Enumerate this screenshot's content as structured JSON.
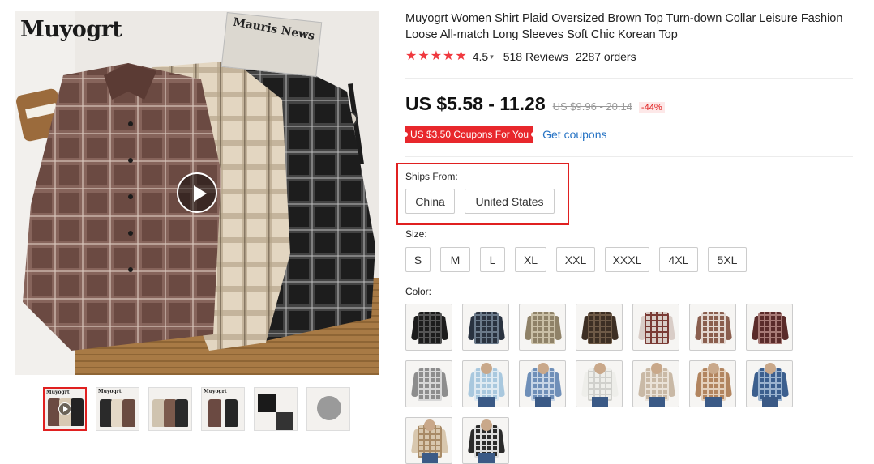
{
  "gallery": {
    "brand_logo": "Muyogrt",
    "newspaper_text": "Mauris News",
    "play_icon": "play-icon",
    "thumbnails": [
      {
        "label": "Muyogrt",
        "kind": "video",
        "active": true
      },
      {
        "label": "Muyogrt",
        "kind": "flatlay",
        "active": false
      },
      {
        "label": "",
        "kind": "rack",
        "active": false
      },
      {
        "label": "Muyogrt",
        "kind": "hanging",
        "active": false
      },
      {
        "label": "",
        "kind": "fabric",
        "active": false
      },
      {
        "label": "",
        "kind": "detail",
        "active": false
      }
    ]
  },
  "product": {
    "title": "Muyogrt Women Shirt Plaid Oversized Brown Top Turn-down Collar Leisure Fashion Loose All-match Long Sleeves Soft Chic Korean Top",
    "rating": "4.5",
    "reviews": "518 Reviews",
    "orders": "2287 orders",
    "price": "US $5.58 - 11.28",
    "original_price": "US $9.96 - 20.14",
    "discount": "-44%",
    "coupon_badge": "US $3.50 Coupons For You",
    "get_coupons": "Get coupons",
    "colors": {
      "star": "#f0383e",
      "accent_red": "#e02020",
      "link": "#2673c4"
    }
  },
  "ships_from": {
    "label": "Ships From:",
    "options": [
      "China",
      "United States"
    ]
  },
  "size": {
    "label": "Size:",
    "options": [
      "S",
      "M",
      "L",
      "XL",
      "XXL",
      "XXXL",
      "4XL",
      "5XL"
    ]
  },
  "color": {
    "label": "Color:",
    "swatches": [
      {
        "name": "black-plaid",
        "main": "#1c1c1c",
        "accent": "#555555",
        "model": false
      },
      {
        "name": "navy-plaid",
        "main": "#2a3340",
        "accent": "#6b7a8a",
        "model": false
      },
      {
        "name": "khaki-plaid",
        "main": "#8f8268",
        "accent": "#c9bfa6",
        "model": false
      },
      {
        "name": "dark-brown-plaid",
        "main": "#3d2f24",
        "accent": "#6e5a47",
        "model": false
      },
      {
        "name": "white-red-plaid",
        "main": "#d9cdc7",
        "accent": "#7a3a34",
        "model": false
      },
      {
        "name": "brown-white-plaid",
        "main": "#8a5e4e",
        "accent": "#e2d6cf",
        "model": false
      },
      {
        "name": "burgundy-plaid",
        "main": "#5a2b2a",
        "accent": "#a77a76",
        "model": false
      },
      {
        "name": "grey-plaid",
        "main": "#8d8d8d",
        "accent": "#d7d7d7",
        "model": false
      },
      {
        "name": "light-blue",
        "main": "#a9c8de",
        "accent": "#dfeaf2",
        "model": true
      },
      {
        "name": "blue-stripe",
        "main": "#6f8fb8",
        "accent": "#c7d5e6",
        "model": true
      },
      {
        "name": "white",
        "main": "#eeeeea",
        "accent": "#d0d0cc",
        "model": true
      },
      {
        "name": "beige-check",
        "main": "#c9b9a6",
        "accent": "#eae2d8",
        "model": true
      },
      {
        "name": "tan-plaid",
        "main": "#b28560",
        "accent": "#e4d0bc",
        "model": true
      },
      {
        "name": "blue-plaid",
        "main": "#3c5f8e",
        "accent": "#9bb3cf",
        "model": true
      },
      {
        "name": "cream-plaid",
        "main": "#d8c7ae",
        "accent": "#a88a66",
        "model": true
      },
      {
        "name": "black-white-plaid",
        "main": "#2b2b2b",
        "accent": "#dcdcdc",
        "model": true
      }
    ]
  }
}
